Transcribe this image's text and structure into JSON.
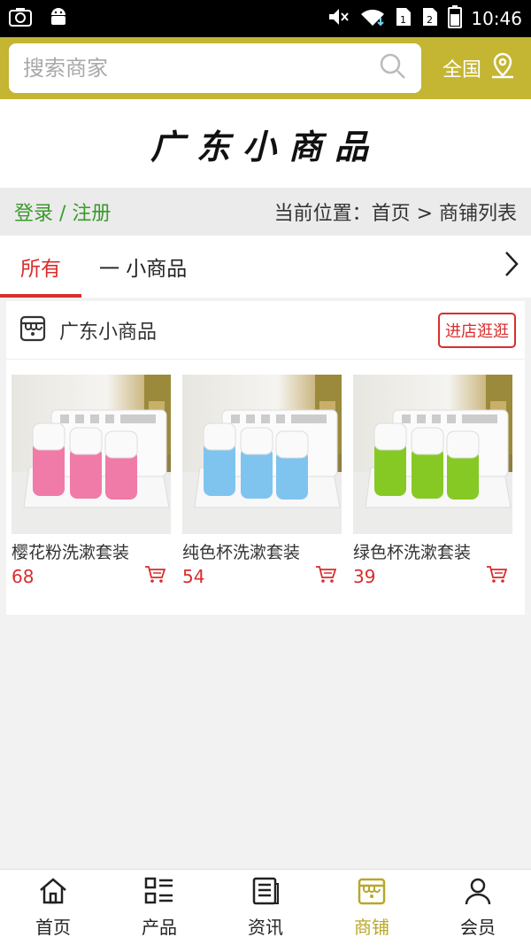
{
  "statusbar": {
    "time": "10:46"
  },
  "search": {
    "placeholder": "搜索商家"
  },
  "region": {
    "label": "全国"
  },
  "banner": {
    "title": "广东小商品"
  },
  "crumbs": {
    "login": "登录 / 注册",
    "path": "当前位置：首页 > 商铺列表"
  },
  "tabs": {
    "all": "所有",
    "sub": "一 小商品"
  },
  "store": {
    "name": "广东小商品",
    "visit_label": "进店逛逛",
    "products": [
      {
        "name": "樱花粉洗漱套装",
        "price": "68",
        "cup_color": "#f07aa8"
      },
      {
        "name": "纯色杯洗漱套装",
        "price": "54",
        "cup_color": "#7fc4ee"
      },
      {
        "name": "绿色杯洗漱套装",
        "price": "39",
        "cup_color": "#86c925"
      }
    ]
  },
  "nav": {
    "items": [
      {
        "label": "首页",
        "icon": "home-icon"
      },
      {
        "label": "产品",
        "icon": "grid-list-icon"
      },
      {
        "label": "资讯",
        "icon": "news-icon"
      },
      {
        "label": "商铺",
        "icon": "store-icon"
      },
      {
        "label": "会员",
        "icon": "user-icon"
      }
    ],
    "active": "商铺",
    "active_color": "#b9a72a"
  },
  "colors": {
    "header": "#c4b533",
    "accent": "#d92d2d",
    "login": "#3a9a2a"
  }
}
